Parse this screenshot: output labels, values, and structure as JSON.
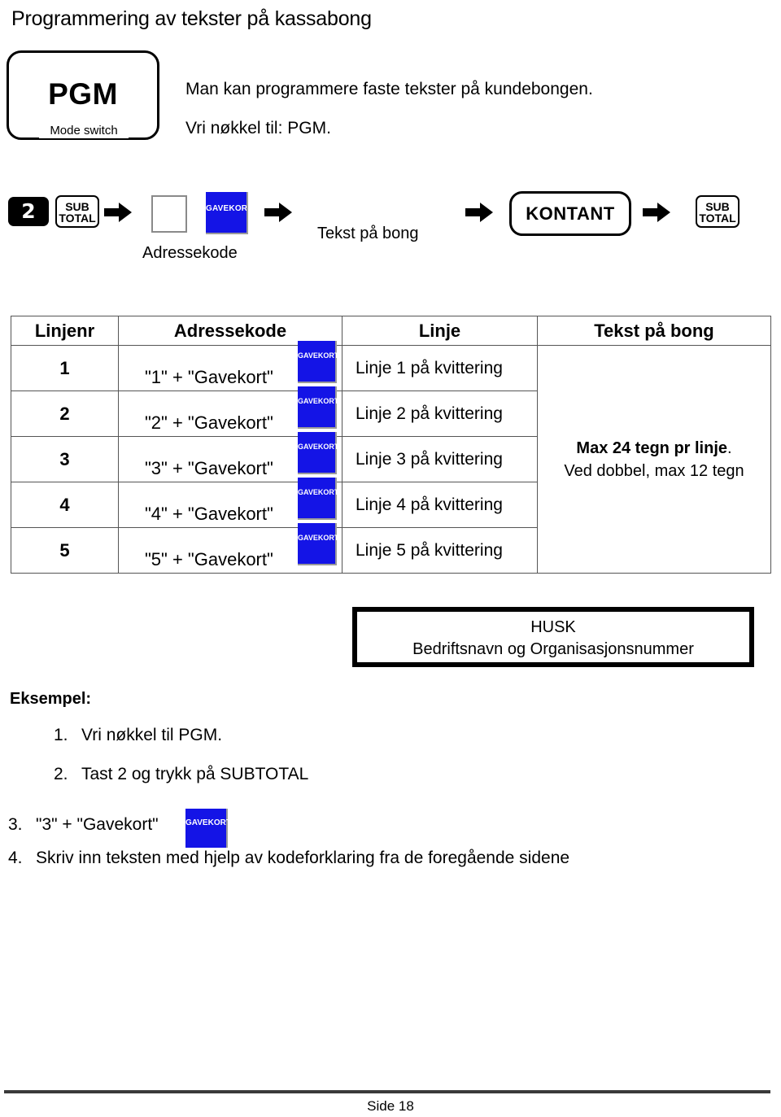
{
  "page": {
    "title": "Programmering av tekster på kassabong",
    "footer_page_label": "Side 18",
    "accent_blue": "#1414e6"
  },
  "mode_switch": {
    "mode_label": "PGM",
    "caption": "Mode switch"
  },
  "intro": {
    "line1": "Man kan programmere faste tekster på kundebongen.",
    "line2": "Vri nøkkel til: PGM."
  },
  "flow": {
    "key_two": "2",
    "key_subtotal_line1": "SUB",
    "key_subtotal_line2": "TOTAL",
    "adressekode_label": "Adressekode",
    "gavekort_label": "GAVEKORT",
    "tekst_pa_bong_label": "Tekst på bong",
    "key_kontant": "KONTANT",
    "key_subtotal2_line1": "SUB",
    "key_subtotal2_line2": "TOTAL",
    "arrow_icon": "arrow-right-icon"
  },
  "table": {
    "headers": [
      "Linjenr",
      "Adressekode",
      "Linje",
      "Tekst på bong"
    ],
    "rows": [
      {
        "num": "1",
        "addr": "\"1\" + \"Gavekort\"",
        "gavekort": "GAVEKORT",
        "linje": "Linje 1 på kvittering"
      },
      {
        "num": "2",
        "addr": "\"2\" + \"Gavekort\"",
        "gavekort": "GAVEKORT",
        "linje": "Linje 2 på kvittering"
      },
      {
        "num": "3",
        "addr": "\"3\" + \"Gavekort\"",
        "gavekort": "GAVEKORT",
        "linje": "Linje 3 på kvittering"
      },
      {
        "num": "4",
        "addr": "\"4\" + \"Gavekort\"",
        "gavekort": "GAVEKORT",
        "linje": "Linje 4 på kvittering"
      },
      {
        "num": "5",
        "addr": "\"5\" + \"Gavekort\"",
        "gavekort": "GAVEKORT",
        "linje": "Linje 5 på kvittering"
      }
    ],
    "note_bold": "Max 24 tegn pr linje",
    "note_bold_suffix": ".",
    "note_regular": "Ved dobbel, max 12 tegn"
  },
  "husk": {
    "line1": "HUSK",
    "line2": "Bedriftsnavn og Organisasjonsnummer"
  },
  "eksempel": {
    "title": "Eksempel:",
    "steps": [
      {
        "idx": "1.",
        "text": "Vri nøkkel til PGM."
      },
      {
        "idx": "2.",
        "text": "Tast 2 og trykk på SUBTOTAL"
      },
      {
        "idx": "3.",
        "text": "\"3\" + \"Gavekort\"",
        "gavekort": "GAVEKORT"
      },
      {
        "idx": "4.",
        "text": "Skriv inn teksten med hjelp av kodeforklaring fra de foregående sidene"
      }
    ]
  }
}
